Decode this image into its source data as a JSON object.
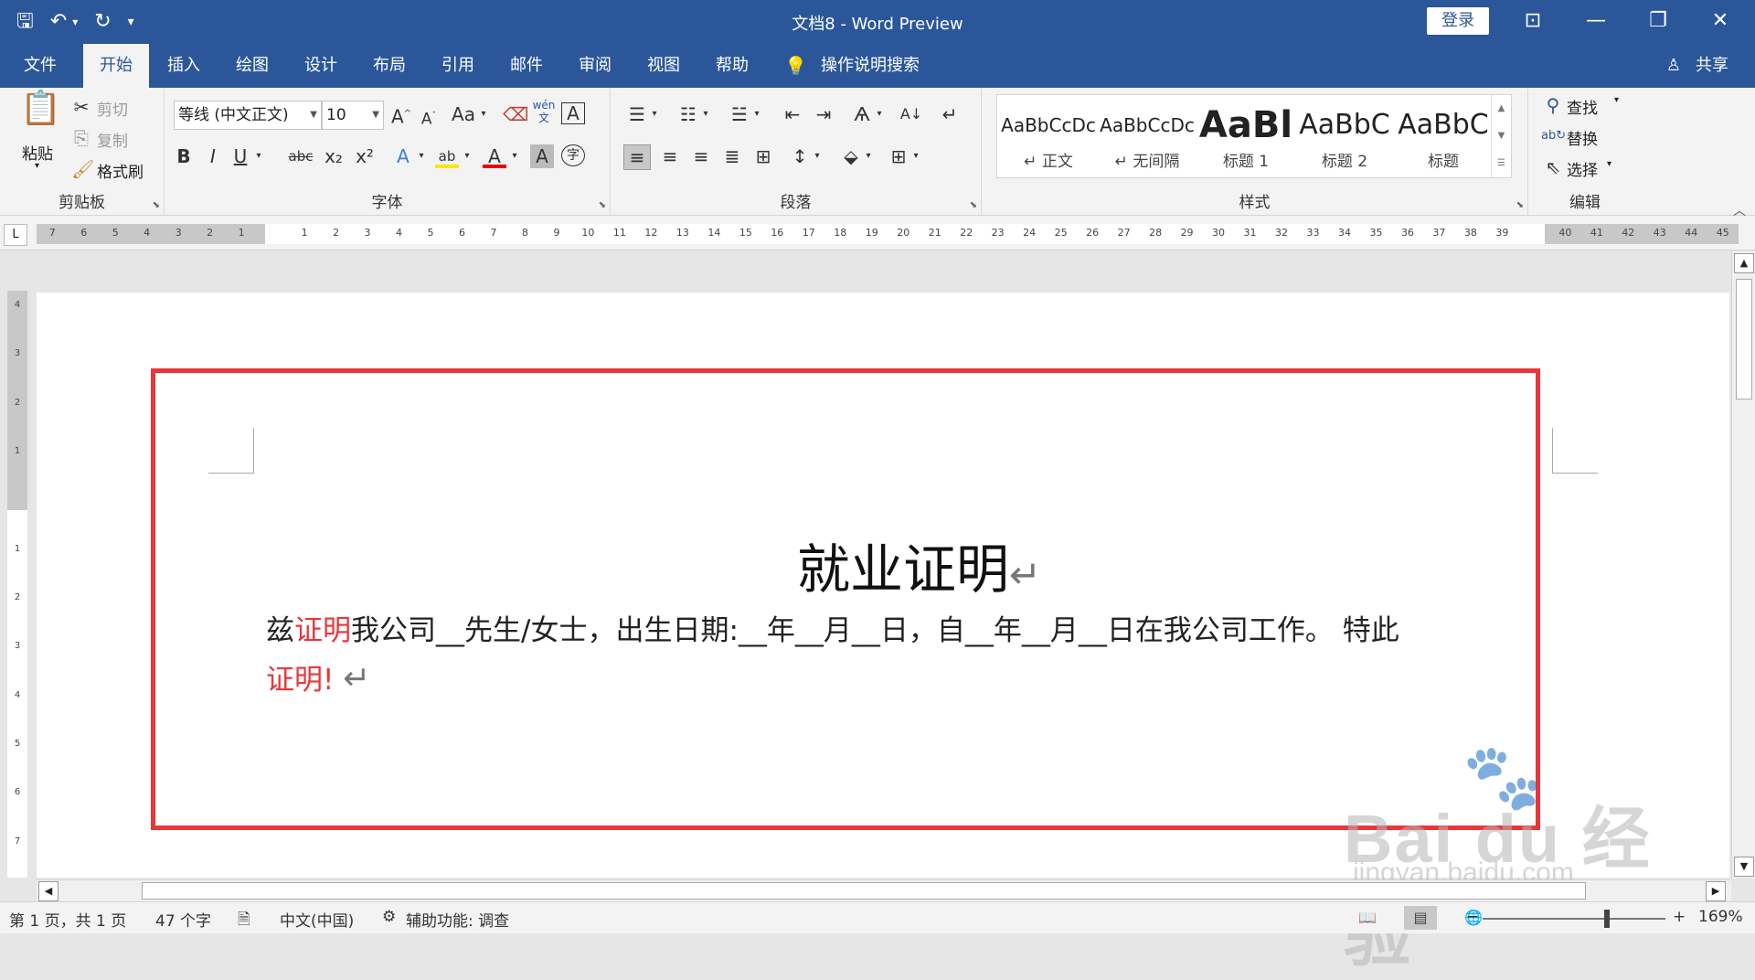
{
  "window": {
    "title": "文档8  -  Word Preview",
    "login_label": "登录"
  },
  "ribbon_tabs": [
    {
      "label": "文件"
    },
    {
      "label": "开始"
    },
    {
      "label": "插入"
    },
    {
      "label": "绘图"
    },
    {
      "label": "设计"
    },
    {
      "label": "布局"
    },
    {
      "label": "引用"
    },
    {
      "label": "邮件"
    },
    {
      "label": "审阅"
    },
    {
      "label": "视图"
    },
    {
      "label": "帮助"
    }
  ],
  "tell_me": "操作说明搜索",
  "share_label": "共享",
  "clipboard": {
    "group_label": "剪贴板",
    "paste_label": "粘贴",
    "cut_label": "剪切",
    "copy_label": "复制",
    "format_painter_label": "格式刷"
  },
  "font": {
    "group_label": "字体",
    "font_name": "等线 (中文正文)",
    "font_size": "10",
    "change_case": "Aa",
    "phonetic": "wén",
    "bold": "B",
    "italic": "I",
    "underline": "U",
    "strikethrough": "abc",
    "subscript": "x₂",
    "superscript": "x²",
    "text_effects": "A",
    "highlight": "ab",
    "font_color": "A",
    "char_shading": "A",
    "enclose": "字"
  },
  "paragraph": {
    "group_label": "段落"
  },
  "styles": {
    "group_label": "样式",
    "items": [
      {
        "preview": "AaBbCcDc",
        "name": "↵ 正文"
      },
      {
        "preview": "AaBbCcDc",
        "name": "↵ 无间隔"
      },
      {
        "preview": "AaBl",
        "name": "标题 1"
      },
      {
        "preview": "AaBbC",
        "name": "标题 2"
      },
      {
        "preview": "AaBbC",
        "name": "标题"
      }
    ]
  },
  "editing": {
    "group_label": "编辑",
    "find_label": "查找",
    "replace_label": "替换",
    "select_label": "选择"
  },
  "ruler": {
    "ticks": [
      "7",
      "6",
      "5",
      "4",
      "3",
      "2",
      "1",
      "",
      "1",
      "2",
      "3",
      "4",
      "5",
      "6",
      "7",
      "8",
      "9",
      "10",
      "11",
      "12",
      "13",
      "14",
      "15",
      "16",
      "17",
      "18",
      "19",
      "20",
      "21",
      "22",
      "23",
      "24",
      "25",
      "26",
      "27",
      "28",
      "29",
      "30",
      "31",
      "32",
      "33",
      "34",
      "35",
      "36",
      "37",
      "38",
      "39",
      "",
      "40",
      "41",
      "42",
      "43",
      "44",
      "45"
    ],
    "vertical_ticks": [
      "4",
      "3",
      "2",
      "1",
      "",
      "1",
      "2",
      "3",
      "4",
      "5",
      "6",
      "7"
    ]
  },
  "document": {
    "heading": "就业证明",
    "paragraph_mark": "↵",
    "body_line1_prefix": "兹",
    "body_line1_red": "证明",
    "body_line1_rest": "我公司__先生/女士，出生日期:__年__月__日，自__年__月__日在我公司工作。  特此",
    "body_line2_red": "证明!",
    "highlight_color": "#e8363a"
  },
  "watermark": {
    "brand": "Bai du 经验",
    "url": "jingyan.baidu.com"
  },
  "status_bar": {
    "page": "第 1 页，共 1 页",
    "words": "47 个字",
    "language": "中文(中国)",
    "accessibility": "辅助功能: 调查",
    "zoom": "169%",
    "zoom_minus": "−",
    "zoom_plus": "+"
  },
  "colors": {
    "title_bar": "#2b579a",
    "ribbon": "#f3f3f3",
    "accent_red": "#e8363a"
  }
}
